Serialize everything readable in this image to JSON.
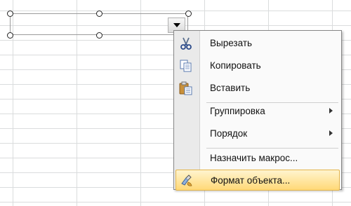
{
  "control": {
    "dropdown_icon": "chevron-down-icon"
  },
  "menu": {
    "items": [
      {
        "label": "Вырезать",
        "icon": "scissors-icon"
      },
      {
        "label": "Копировать",
        "icon": "copy-icon"
      },
      {
        "label": "Вставить",
        "icon": "paste-icon"
      },
      {
        "label": "Группировка",
        "submenu": true
      },
      {
        "label": "Порядок",
        "submenu": true
      },
      {
        "label": "Назначить макрос..."
      },
      {
        "label": "Формат объекта...",
        "icon": "format-object-icon",
        "highlighted": true
      }
    ]
  },
  "colors": {
    "highlight_top": "#fff4cf",
    "highlight_bottom": "#ffd977",
    "gridline": "#dadcdd"
  }
}
